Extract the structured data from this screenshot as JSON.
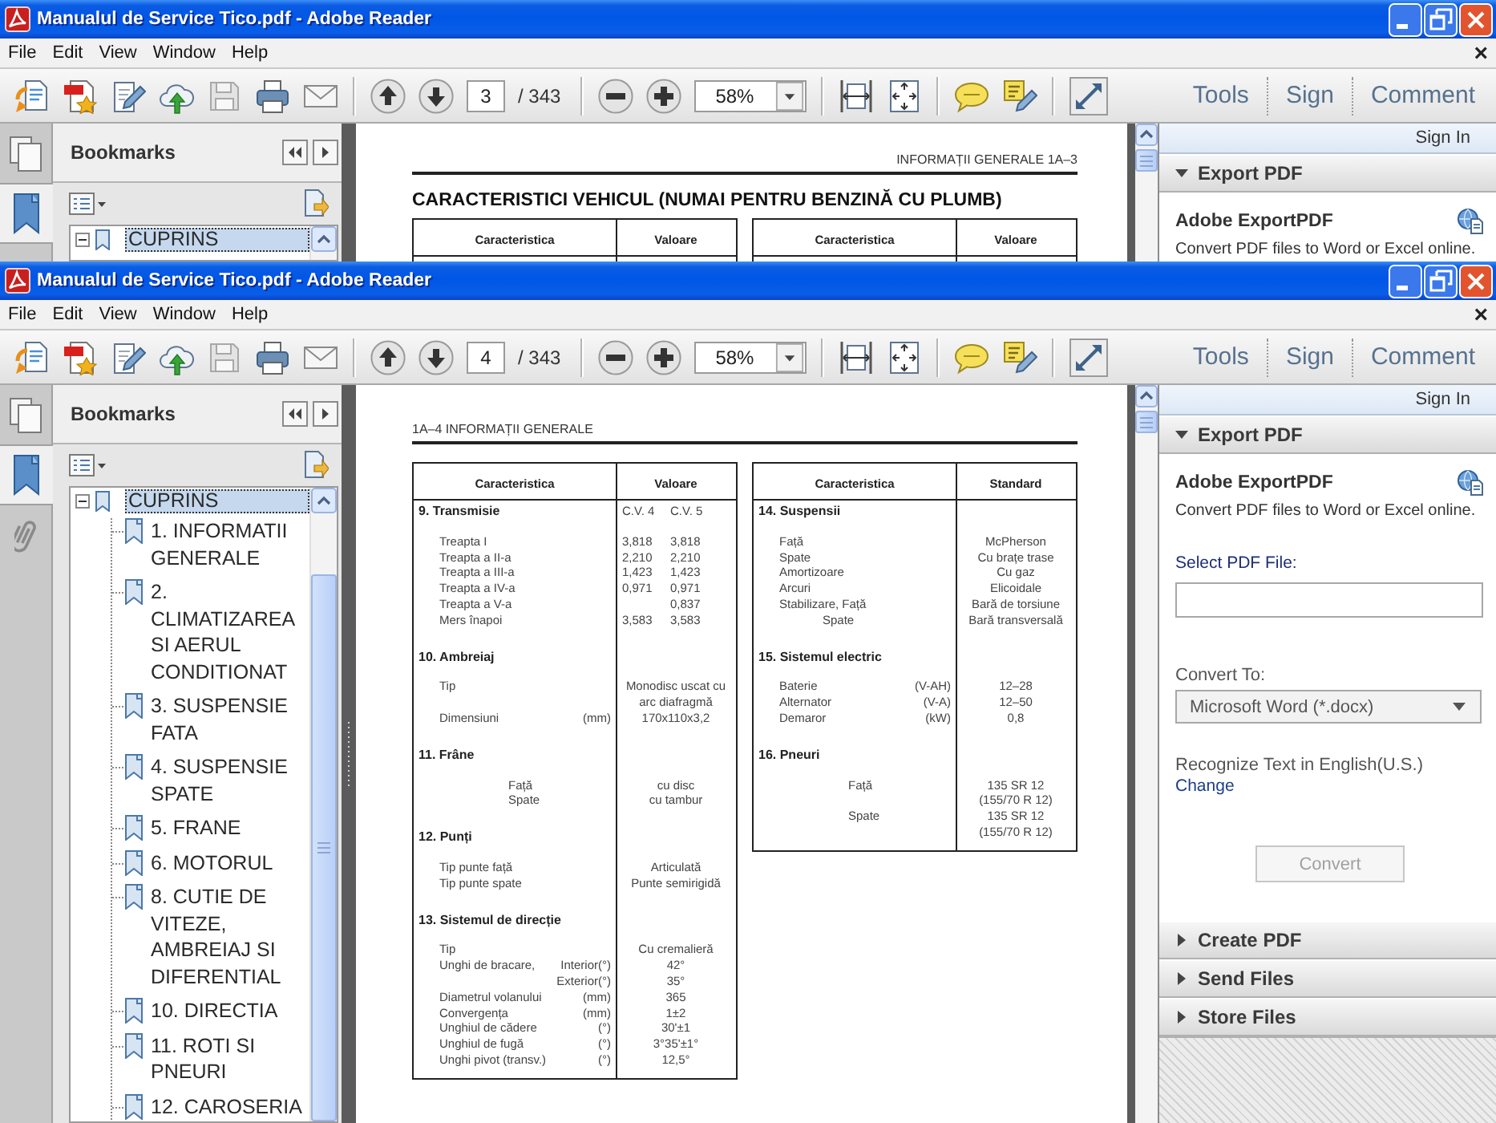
{
  "windows": [
    {
      "title": "Manualul de Service Tico.pdf - Adobe Reader",
      "menu": [
        "File",
        "Edit",
        "View",
        "Window",
        "Help"
      ],
      "menu_close": "×",
      "toolbar": {
        "page_number": "3",
        "page_total": "/ 343",
        "zoom": "58%",
        "task_buttons": [
          "Tools",
          "Sign",
          "Comment"
        ]
      },
      "nav_tabs": [
        {
          "kind": "pages",
          "selected": false
        },
        {
          "kind": "bookmarks",
          "selected": true
        }
      ],
      "bookmarks": {
        "title": "Bookmarks",
        "items": [
          {
            "label": "CUPRINS",
            "selected": true,
            "expanded": true
          }
        ]
      },
      "document": {
        "running_head": {
          "text": "INFORMAȚII GENERALE 1A–3",
          "kind": "odd"
        },
        "title": "CARACTERISTICI VEHICUL (NUMAI PENTRU BENZINĂ CU PLUMB)",
        "tables": [
          {
            "columns": [
              "Caracteristica",
              "Valoare"
            ]
          },
          {
            "columns": [
              "Caracteristica",
              "Valoare"
            ]
          }
        ]
      },
      "tools_pane": {
        "sign_in": "Sign In",
        "panels": [
          {
            "title": "Export PDF",
            "expanded": true
          }
        ],
        "export_pdf": {
          "heading": "Adobe ExportPDF",
          "description": "Convert PDF files to Word or Excel online."
        }
      }
    },
    {
      "title": "Manualul de Service Tico.pdf - Adobe Reader",
      "menu": [
        "File",
        "Edit",
        "View",
        "Window",
        "Help"
      ],
      "menu_close": "×",
      "toolbar": {
        "page_number": "4",
        "page_total": "/ 343",
        "zoom": "58%",
        "task_buttons": [
          "Tools",
          "Sign",
          "Comment"
        ]
      },
      "nav_tabs": [
        {
          "kind": "pages",
          "selected": false
        },
        {
          "kind": "bookmarks",
          "selected": true
        },
        {
          "kind": "attachments",
          "selected": false
        }
      ],
      "bookmarks": {
        "title": "Bookmarks",
        "items": [
          {
            "label": "CUPRINS",
            "selected": true,
            "expanded": true,
            "children": [
              {
                "label": "1. INFORMATII GENERALE",
                "selected": false
              },
              {
                "label": "2. CLIMATIZAREA SI AERUL CONDITIONAT",
                "selected": false
              },
              {
                "label": "3. SUSPENSIE FATA",
                "selected": false
              },
              {
                "label": "4. SUSPENSIE SPATE",
                "selected": false
              },
              {
                "label": "5. FRANE",
                "selected": false
              },
              {
                "label": "6. MOTORUL",
                "selected": false
              },
              {
                "label": "8. CUTIE DE VITEZE, AMBREIAJ SI DIFERENTIAL",
                "selected": false
              },
              {
                "label": "10. DIRECTIA",
                "selected": false
              },
              {
                "label": "11. ROTI SI PNEURI",
                "selected": false
              },
              {
                "label": "12. CAROSERIA",
                "selected": false
              }
            ]
          }
        ]
      },
      "document": {
        "running_head": {
          "text": "1A–4 INFORMAȚII GENERALE",
          "kind": "even"
        },
        "tables": [
          {
            "columns": [
              "Caracteristica",
              "Valoare"
            ],
            "sections": [
              {
                "heading": "9. Transmisie",
                "col_a": "C.V. 4",
                "col_b": "C.V. 5",
                "rows": [
                  {
                    "kind": "item",
                    "label": "Treapta I",
                    "col_a": "3,818",
                    "col_b": "3,818"
                  },
                  {
                    "kind": "item",
                    "label": "Treapta a II-a",
                    "col_a": "2,210",
                    "col_b": "2,210"
                  },
                  {
                    "kind": "item",
                    "label": "Treapta a III-a",
                    "col_a": "1,423",
                    "col_b": "1,423"
                  },
                  {
                    "kind": "item",
                    "label": "Treapta a IV-a",
                    "col_a": "0,971",
                    "col_b": "0,971"
                  },
                  {
                    "kind": "item",
                    "label": "Treapta a V-a",
                    "col_b": "0,837"
                  },
                  {
                    "kind": "item",
                    "label": "Mers înapoi",
                    "col_a": "3,583",
                    "col_b": "3,583"
                  }
                ]
              },
              {
                "heading": "10. Ambreiaj",
                "rows": [
                  {
                    "kind": "item",
                    "label": "Tip",
                    "value": "Monodisc uscat cu arc diafragmă"
                  },
                  {
                    "kind": "item",
                    "label": "Dimensiuni",
                    "unit": "(mm)",
                    "value": "170x110x3,2"
                  }
                ]
              },
              {
                "heading": "11. Frâne",
                "rows": [
                  {
                    "kind": "sub",
                    "label": "Față",
                    "value": "cu disc"
                  },
                  {
                    "kind": "sub",
                    "label": "Spate",
                    "value": "cu tambur"
                  }
                ]
              },
              {
                "heading": "12. Punți",
                "rows": [
                  {
                    "kind": "item",
                    "label": "Tip punte față",
                    "value": "Articulată"
                  },
                  {
                    "kind": "item",
                    "label": "Tip punte spate",
                    "value": "Punte semirigidă"
                  }
                ]
              },
              {
                "heading": "13. Sistemul de direcție",
                "rows": [
                  {
                    "kind": "item",
                    "label": "Tip",
                    "value": "Cu cremalieră"
                  },
                  {
                    "kind": "item",
                    "label": "Unghi de bracare,",
                    "unit": "Interior(°)",
                    "value": "42°"
                  },
                  {
                    "kind": "item",
                    "unit": "Exterior(°)",
                    "value": "35°"
                  },
                  {
                    "kind": "item",
                    "label": "Diametrul volanului",
                    "unit": "(mm)",
                    "value": "365"
                  },
                  {
                    "kind": "item",
                    "label": "Convergența",
                    "unit": "(mm)",
                    "value": "1±2"
                  },
                  {
                    "kind": "item",
                    "label": "Unghiul de cădere",
                    "unit": "(°)",
                    "value": "30'±1"
                  },
                  {
                    "kind": "item",
                    "label": "Unghiul de fugă",
                    "unit": "(°)",
                    "value": "3°35'±1°"
                  },
                  {
                    "kind": "item",
                    "label": "Unghi pivot (transv.)",
                    "unit": "(°)",
                    "value": "12,5°"
                  }
                ]
              }
            ]
          },
          {
            "columns": [
              "Caracteristica",
              "Standard"
            ],
            "sections": [
              {
                "heading": "14. Suspensii",
                "rows": [
                  {
                    "kind": "item",
                    "label": "Față",
                    "value": "McPherson"
                  },
                  {
                    "kind": "item",
                    "label": "Spate",
                    "value": "Cu brațe trase"
                  },
                  {
                    "kind": "item",
                    "label": "Amortizoare",
                    "value": "Cu gaz"
                  },
                  {
                    "kind": "item",
                    "label": "Arcuri",
                    "value": "Elicoidale"
                  },
                  {
                    "kind": "item",
                    "label": "Stabilizare, Față",
                    "value": "Bară de torsiune"
                  },
                  {
                    "kind": "continuation",
                    "label": "Spate",
                    "value": "Bară transversală"
                  }
                ]
              },
              {
                "heading": "15. Sistemul electric",
                "rows": [
                  {
                    "kind": "item",
                    "label": "Baterie",
                    "unit": "(V-AH)",
                    "value": "12–28"
                  },
                  {
                    "kind": "item",
                    "label": "Alternator",
                    "unit": "(V-A)",
                    "value": "12–50"
                  },
                  {
                    "kind": "item",
                    "label": "Demaror",
                    "unit": "(kW)",
                    "value": "0,8"
                  }
                ]
              },
              {
                "heading": "16. Pneuri",
                "rows": [
                  {
                    "kind": "sub",
                    "label": "Față",
                    "value": "135 SR 12"
                  },
                  {
                    "kind": "sub",
                    "value": "(155/70 R 12)"
                  },
                  {
                    "kind": "sub",
                    "label": "Spate",
                    "value": "135 SR 12"
                  },
                  {
                    "kind": "sub",
                    "value": "(155/70 R 12)"
                  }
                ]
              }
            ]
          }
        ]
      },
      "tools_pane": {
        "sign_in": "Sign In",
        "panels": [
          {
            "title": "Export PDF",
            "expanded": true
          },
          {
            "title": "Create PDF",
            "expanded": false
          },
          {
            "title": "Send Files",
            "expanded": false
          },
          {
            "title": "Store Files",
            "expanded": false
          }
        ],
        "export_pdf": {
          "heading": "Adobe ExportPDF",
          "description": "Convert PDF files to Word or Excel online.",
          "file_label": "Select PDF File:",
          "convert_label": "Convert To:",
          "format": "Microsoft Word (*.docx)",
          "ocr_note": "Recognize Text in English(U.S.)",
          "ocr_link": "Change",
          "convert_button": {
            "label": "Convert",
            "disabled": true
          }
        }
      }
    }
  ]
}
